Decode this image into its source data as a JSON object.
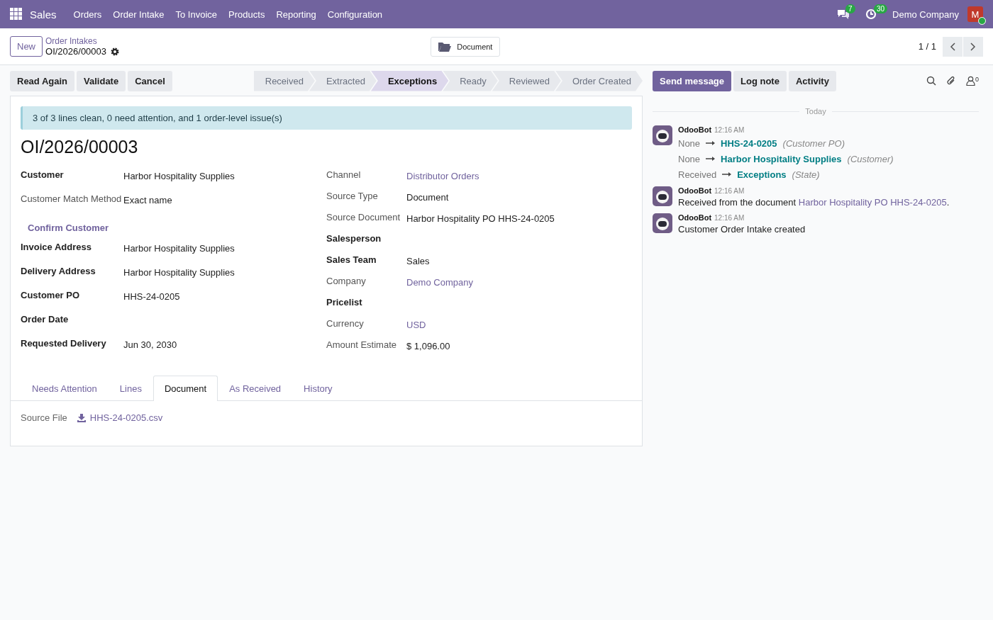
{
  "navbar": {
    "app": "Sales",
    "menu": [
      "Orders",
      "Order Intake",
      "To Invoice",
      "Products",
      "Reporting",
      "Configuration"
    ],
    "messages_badge": "7",
    "activities_badge": "30",
    "company": "Demo Company",
    "user_initial": "M",
    "online": true
  },
  "control_panel": {
    "new_button": "New",
    "breadcrumb": "Order Intakes",
    "record": "OI/2026/00003",
    "center_button": "Document",
    "pager": "1 / 1"
  },
  "actions": [
    "Read Again",
    "Validate",
    "Cancel"
  ],
  "statusbar": [
    {
      "label": "Received",
      "selected": false
    },
    {
      "label": "Extracted",
      "selected": false
    },
    {
      "label": "Exceptions",
      "selected": true
    },
    {
      "label": "Ready",
      "selected": false
    },
    {
      "label": "Reviewed",
      "selected": false
    },
    {
      "label": "Order Created",
      "selected": false
    }
  ],
  "form": {
    "alert": "3 of 3 lines clean, 0 need attention, and 1 order-level issue(s)",
    "title": "OI/2026/00003",
    "left": [
      {
        "kind": "field",
        "label": "Customer",
        "value": "Harbor Hospitality Supplies",
        "required": true,
        "link": false
      },
      {
        "kind": "field",
        "label": "Customer Match Method",
        "value": "Exact name",
        "required": false,
        "link": false
      },
      {
        "kind": "button",
        "label": "Confirm Customer"
      },
      {
        "kind": "field",
        "label": "Invoice Address",
        "value": "Harbor Hospitality Supplies",
        "required": true,
        "link": false
      },
      {
        "kind": "field",
        "label": "Delivery Address",
        "value": "Harbor Hospitality Supplies",
        "required": true,
        "link": false
      },
      {
        "kind": "field",
        "label": "Customer PO",
        "value": "HHS-24-0205",
        "required": true,
        "link": false
      },
      {
        "kind": "field",
        "label": "Order Date",
        "required": true
      },
      {
        "kind": "field",
        "label": "Requested Delivery",
        "value": "Jun 30, 2030",
        "required": true,
        "link": false
      }
    ],
    "right": [
      {
        "kind": "field",
        "label": "Channel",
        "value": "Distributor Orders",
        "required": false,
        "link": true
      },
      {
        "kind": "field",
        "label": "Source Type",
        "value": "Document",
        "required": false,
        "link": false
      },
      {
        "kind": "field",
        "label": "Source Document",
        "value": "Harbor Hospitality PO HHS-24-0205",
        "required": false,
        "link": false
      },
      {
        "kind": "field",
        "label": "Salesperson",
        "required": true
      },
      {
        "kind": "field",
        "label": "Sales Team",
        "value": "Sales",
        "required": true,
        "link": false
      },
      {
        "kind": "field",
        "label": "Company",
        "value": "Demo Company",
        "required": false,
        "link": true
      },
      {
        "kind": "field",
        "label": "Pricelist",
        "required": true
      },
      {
        "kind": "field",
        "label": "Currency",
        "value": "USD",
        "required": false,
        "link": true
      },
      {
        "kind": "field",
        "label": "Amount Estimate",
        "value": "$ 1,096.00",
        "required": false,
        "link": false
      }
    ],
    "tabs": [
      {
        "label": "Needs Attention",
        "selected": false
      },
      {
        "label": "Lines",
        "selected": false
      },
      {
        "label": "Document",
        "selected": true
      },
      {
        "label": "As Received",
        "selected": false
      },
      {
        "label": "History",
        "selected": false
      }
    ],
    "source_file": {
      "label": "Source File",
      "file": "HHS-24-0205.csv"
    }
  },
  "chatter": {
    "buttons": [
      {
        "label": "Send message",
        "selected": true
      },
      {
        "label": "Log note",
        "selected": false
      },
      {
        "label": "Activity",
        "selected": false
      }
    ],
    "followers": "0",
    "divider": "Today",
    "messages": [
      {
        "kind": "tracking",
        "author": "OdooBot",
        "time": "12:16 AM",
        "changes": [
          {
            "old": "None",
            "new": "HHS-24-0205",
            "field": "(Customer PO)"
          },
          {
            "old": "None",
            "new": "Harbor Hospitality Supplies",
            "field": "(Customer)"
          },
          {
            "old": "Received",
            "new": "Exceptions",
            "field": "(State)"
          }
        ]
      },
      {
        "kind": "text",
        "author": "OdooBot",
        "time": "12:16 AM",
        "text": "Received from the document ",
        "link": "Harbor Hospitality PO HHS-24-0205",
        "after": "."
      },
      {
        "kind": "text",
        "author": "OdooBot",
        "time": "12:16 AM",
        "text": "Customer Order Intake created"
      }
    ]
  }
}
